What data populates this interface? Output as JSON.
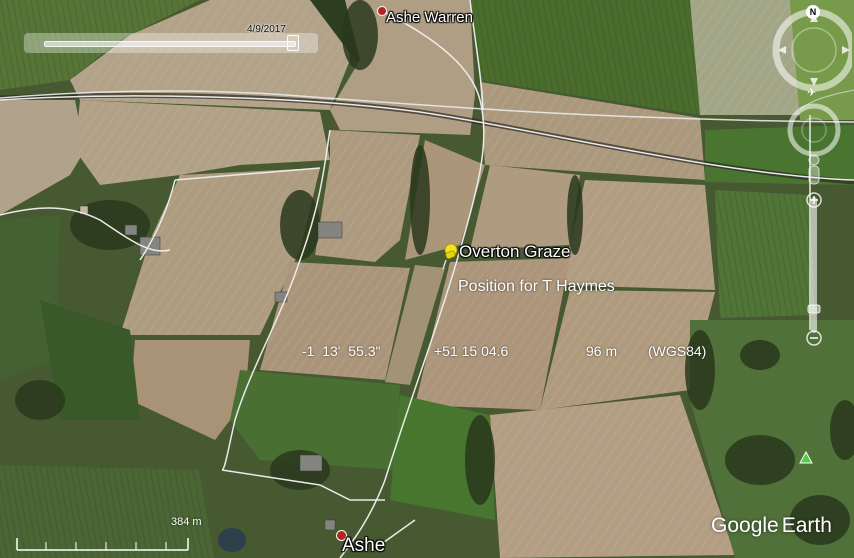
{
  "places": {
    "ashe_warren": "Ashe Warren",
    "ashe": "Ashe"
  },
  "placemark": {
    "name": "Overton Graze",
    "description": "Position for T Haymes",
    "icon": "yellow-pushpin-icon"
  },
  "coordinates": {
    "longitude": "-1  13'  55.3\"",
    "latitude": "+51 15 04.6",
    "altitude": "96 m",
    "datum": "(WGS84)"
  },
  "time_slider": {
    "date": "4/9/2017"
  },
  "navigation": {
    "north_label": "N"
  },
  "scale_bar": {
    "label": "384 m"
  },
  "branding": {
    "google": "Google",
    "earth": "Earth"
  },
  "colors": {
    "road": "#f4f4f4",
    "pin": "#f2e21b",
    "place_dot": "#b3261e",
    "tree_marker": "#4ccf44"
  }
}
